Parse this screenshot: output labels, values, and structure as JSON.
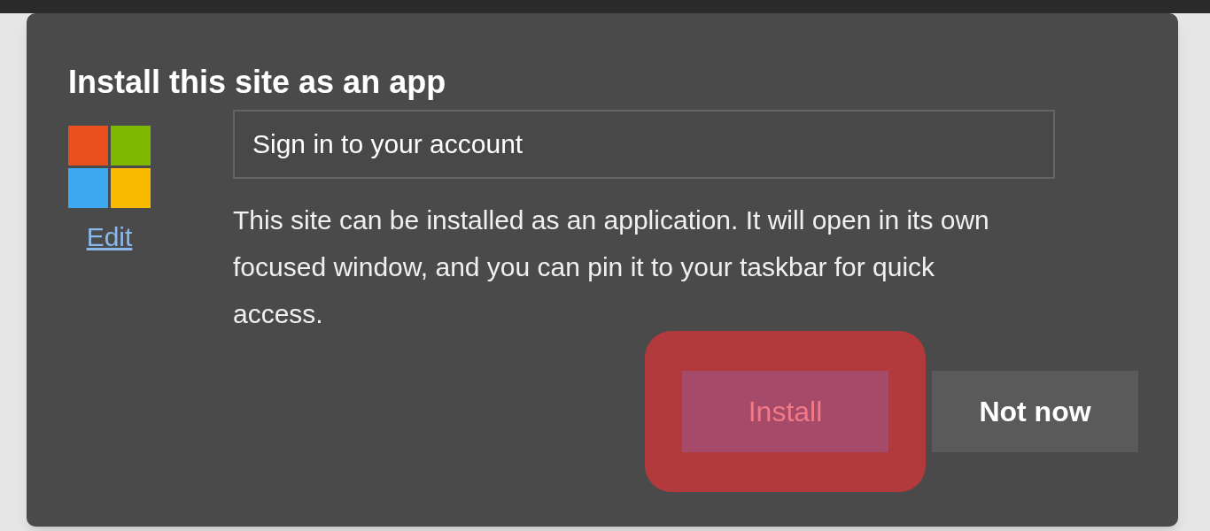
{
  "dialog": {
    "title": "Install this site as an app",
    "edit_link": "Edit",
    "name_field": {
      "value": "Sign in to your account"
    },
    "description": "This site can be installed as an application. It will open in its own focused window, and you can pin it to your taskbar for quick access.",
    "buttons": [
      {
        "label": "Install",
        "kind": "primary",
        "highlighted": true
      },
      {
        "label": "Not now",
        "kind": "secondary",
        "highlighted": false
      }
    ]
  }
}
